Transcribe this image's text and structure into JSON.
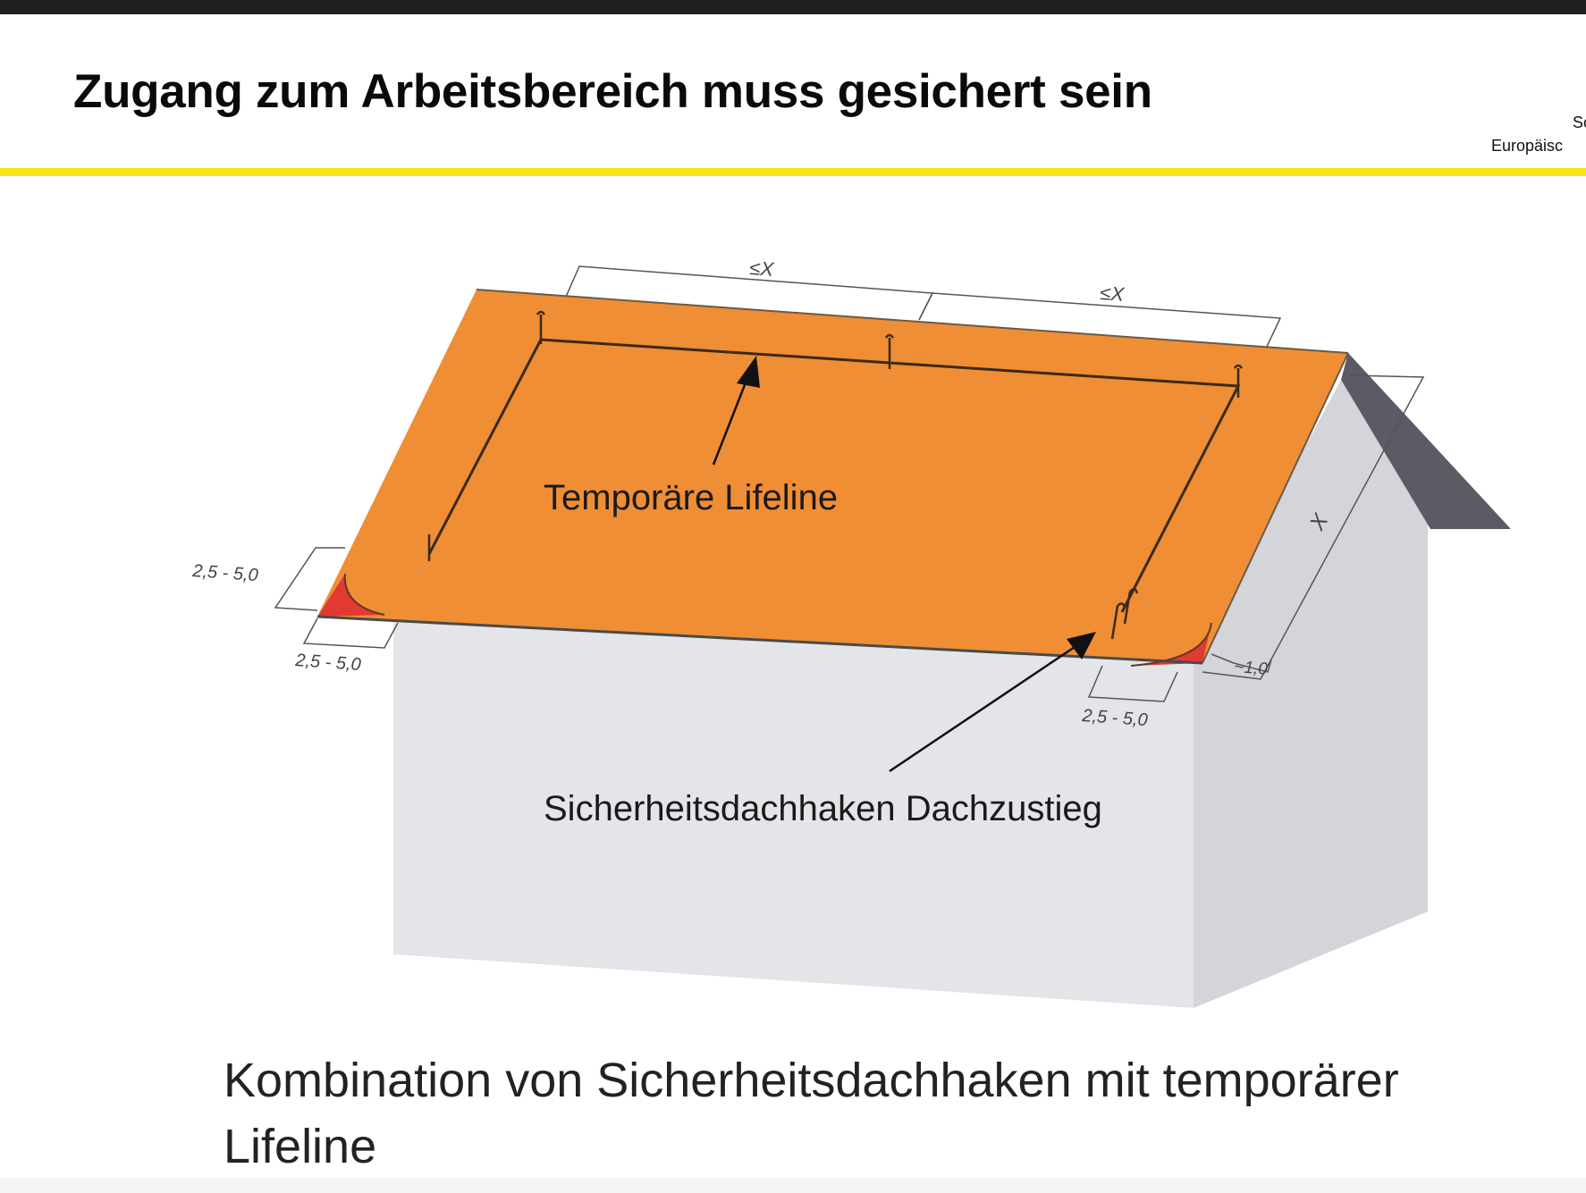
{
  "slide": {
    "title": "Zugang zum Arbeitsbereich muss gesichert sein",
    "header_right_line1": "Sc",
    "header_right_line2": "Europäisc",
    "caption": "Kombination von Sicherheitsdachhaken mit temporärer Lifeline"
  },
  "diagram": {
    "label_lifeline": "Temporäre Lifeline",
    "label_hook": "Sicherheitsdachhaken Dachzustieg",
    "dim_top_left": "≤X",
    "dim_top_right": "≤X",
    "dim_side": "X",
    "dim_left_upper": "2,5 - 5,0",
    "dim_left_lower": "2,5 - 5,0",
    "dim_right_lower": "2,5 - 5,0",
    "dim_right_small": "~1,0"
  },
  "colors": {
    "roof": "#ef8e35",
    "roof_corner": "#e03a33",
    "gable_roof": "#5b5b66",
    "wall_front": "#e4e5e9",
    "wall_side": "#d4d5da",
    "accent_rule": "#f7e51b",
    "top_bar": "#202020"
  }
}
